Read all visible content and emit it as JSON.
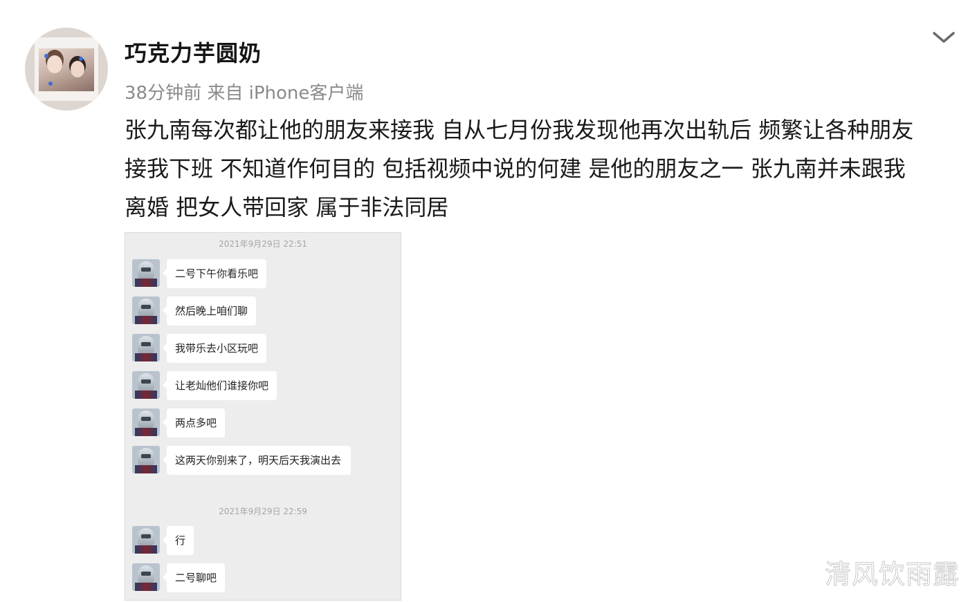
{
  "post": {
    "username": "巧克力芋圆奶",
    "meta": "38分钟前 来自 iPhone客户端",
    "text_lines": [
      "张九南每次都让他的朋友来接我 自从七月份我发现他再次出轨后 频繁让各种朋友",
      "接我下班 不知道作何目的 包括视频中说的何建 是他的朋友之一 张九南并未跟我",
      "离婚 把女人带回家 属于非法同居"
    ]
  },
  "icons": {
    "menu": "chevron-down-icon",
    "avatar": "avatar"
  },
  "chat": {
    "timestamps": [
      "2021年9月29日 22:51",
      "2021年9月29日 22:59"
    ],
    "messages": [
      "二号下午你看乐吧",
      "然后晚上咱们聊",
      "我带乐去小区玩吧",
      "让老灿他们谁接你吧",
      "两点多吧",
      "这两天你别来了，明天后天我演出去",
      "行",
      "二号聊吧"
    ]
  },
  "watermark": "清风饮雨露",
  "colors": {
    "meta_gray": "#8a8a8a",
    "chat_background": "#ededed",
    "bubble": "#ffffff"
  }
}
